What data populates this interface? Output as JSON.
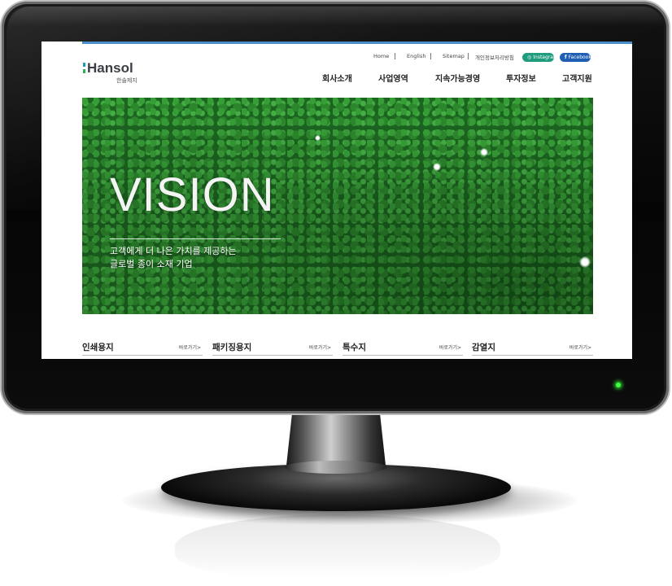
{
  "header": {
    "logo_text": "Hansol",
    "logo_sub": "한솔제지",
    "util_links": [
      "Home",
      "English",
      "Sitemap",
      "개인정보처리방침"
    ],
    "social": [
      {
        "label": "Instagram",
        "icon": "instagram-icon",
        "color": "#1f9b7e"
      },
      {
        "label": "Facebook",
        "icon": "facebook-icon",
        "color": "#1e5fb4"
      }
    ],
    "nav": [
      "회사소개",
      "사업영역",
      "지속가능경영",
      "투자정보",
      "고객지원"
    ]
  },
  "hero": {
    "title": "VISION",
    "subtitle": "고객에게 더 나은 가치를 제공하는\n글로벌 종이 소재 기업"
  },
  "categories": [
    {
      "title": "인쇄용지",
      "link": "바로가기>"
    },
    {
      "title": "패키징용지",
      "link": "바로가기>"
    },
    {
      "title": "특수지",
      "link": "바로가기>"
    },
    {
      "title": "감열지",
      "link": "바로가기>"
    }
  ],
  "colors": {
    "accent_line": "#4a8fc9",
    "instagram": "#1f9b7e",
    "facebook": "#1e5fb4",
    "power_led": "#3dff3d"
  }
}
